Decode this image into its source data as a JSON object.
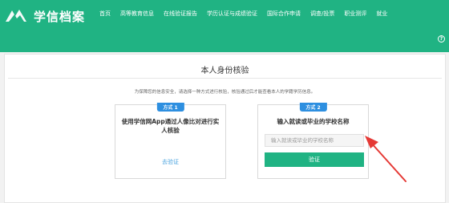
{
  "header": {
    "logo_text": "学信档案",
    "nav": [
      "首页",
      "高等教育信息",
      "在线验证报告",
      "学历认证与成绩验证",
      "国际合作申请",
      "调查/投票",
      "职业测评",
      "就业"
    ]
  },
  "main": {
    "title": "本人身份核验",
    "notice": "为保障您的信息安全，请选择一种方式进行核验，核验通过后才能查看本人的学籍学历信息。",
    "methods": [
      {
        "badge": "方式 1",
        "description": "使用学信网App通过人像比对进行实人核验",
        "link": "去验证"
      },
      {
        "badge": "方式 2",
        "description": "输入就读或毕业的学校名称",
        "input_value": "",
        "input_placeholder": "输入就读或毕业的学校名称",
        "button": "验证"
      }
    ]
  },
  "colors": {
    "brand_green": "#20b383",
    "badge_blue": "#2d8fe0",
    "link_blue": "#4aa3df",
    "annotation_red": "#e53935"
  },
  "icons": {
    "logo": "wing-logo-icon",
    "help": "help-icon",
    "annotation": "red-arrow-annotation"
  }
}
